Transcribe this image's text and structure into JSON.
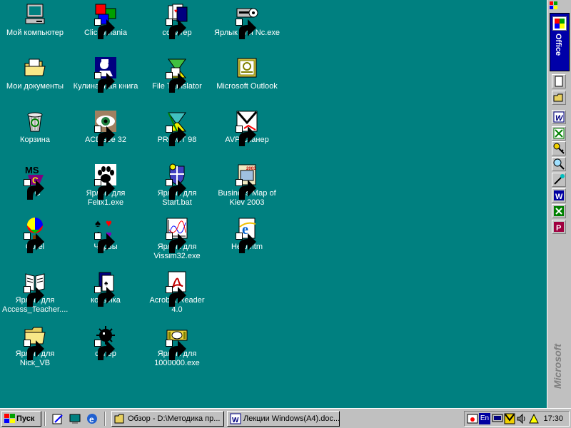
{
  "desktop": {
    "icons": [
      {
        "label": "Мой компьютер"
      },
      {
        "label": "Мои документы"
      },
      {
        "label": "Корзина"
      },
      {
        "label": "VC"
      },
      {
        "label": "Corel"
      },
      {
        "label": "Ярлык для Access_Teacher...."
      },
      {
        "label": "Ярлык для Nick_VB"
      },
      {
        "label": "Clickomania"
      },
      {
        "label": "Кулинарная книга"
      },
      {
        "label": "ACDSee 32"
      },
      {
        "label": "Ярлык для Felix1.exe"
      },
      {
        "label": "Червы"
      },
      {
        "label": "косынка"
      },
      {
        "label": "сапер"
      },
      {
        "label": "солитер"
      },
      {
        "label": "File Translator"
      },
      {
        "label": "PROMT 98"
      },
      {
        "label": "Ярлык для Start.bat"
      },
      {
        "label": "Ярлык для Vissim32.exe"
      },
      {
        "label": "Acrobat Reader 4.0"
      },
      {
        "label": "Ярлык для 1000000.exe"
      },
      {
        "label": "Ярлык для Nc.exe"
      },
      {
        "label": "Microsoft Outlook"
      },
      {
        "label": "AVP Сканер"
      },
      {
        "label": "Business Map of Kiev 2003"
      },
      {
        "label": "Help.htm"
      }
    ]
  },
  "office_bar": {
    "tab_label": "Office",
    "brand": "Microsoft"
  },
  "taskbar": {
    "start_label": "Пуск",
    "tasks": [
      {
        "label": "Обзор - D:\\Методика пр..."
      },
      {
        "label": "Лекции Windows(A4).doc..."
      }
    ],
    "tray": {
      "language": "En",
      "clock": "17:30"
    }
  },
  "colors": {
    "desktop": "#008080",
    "face": "#c0c0c0",
    "office_tab": "#0000a8"
  }
}
